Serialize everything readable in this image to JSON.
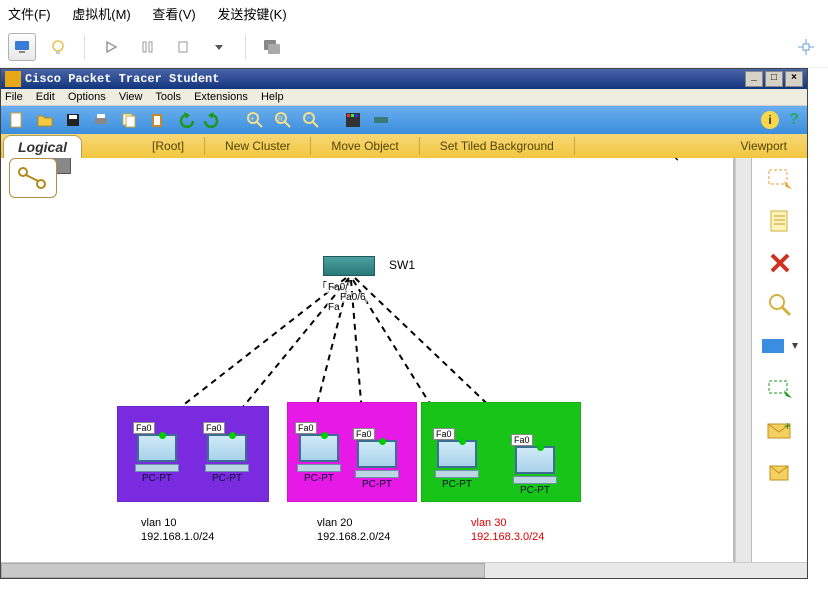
{
  "vm_menu": [
    "文件(F)",
    "虚拟机(M)",
    "查看(V)",
    "发送按键(K)"
  ],
  "pt_title": "Cisco Packet Tracer Student",
  "pt_menu": [
    "File",
    "Edit",
    "Options",
    "View",
    "Tools",
    "Extensions",
    "Help"
  ],
  "tabbar": {
    "logical": "Logical",
    "root": "[Root]",
    "newcluster": "New Cluster",
    "moveobj": "Move Object",
    "tiled": "Set Tiled Background",
    "viewport": "Viewport"
  },
  "switch": {
    "label": "SW1",
    "ports": [
      "Fa0/",
      "Fa0/6",
      "Fa"
    ]
  },
  "pc_label": "PC-PT",
  "fa_label": "Fa0",
  "vlans": [
    {
      "name": "vlan 10",
      "cidr": "192.168.1.0/24"
    },
    {
      "name": "vlan 20",
      "cidr": "192.168.2.0/24"
    },
    {
      "name": "vlan 30",
      "cidr": "192.168.3.0/24"
    }
  ]
}
